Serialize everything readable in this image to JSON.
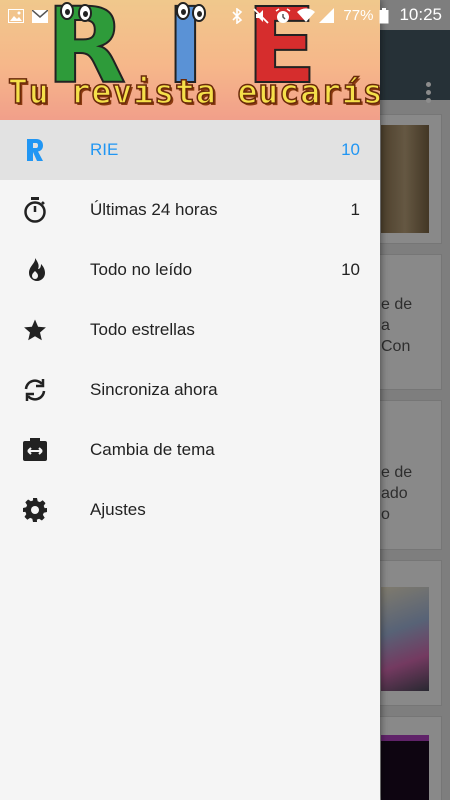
{
  "status_bar": {
    "battery_pct": "77%",
    "time": "10:25",
    "icons": [
      "image-icon",
      "mail-icon",
      "bluetooth-icon",
      "mute-icon",
      "alarm-icon",
      "wifi-icon",
      "signal-icon",
      "battery-icon"
    ]
  },
  "drawer": {
    "header": {
      "logo_letters": [
        "R",
        "I",
        "E"
      ],
      "tagline": "Tu revista eucarística"
    },
    "items": [
      {
        "label": "RIE",
        "count": "10",
        "icon": "rie-logo-icon",
        "active": true
      },
      {
        "label": "Últimas 24 horas",
        "count": "1",
        "icon": "stopwatch-icon"
      },
      {
        "label": "Todo no leído",
        "count": "10",
        "icon": "flame-icon"
      },
      {
        "label": "Todo estrellas",
        "count": "",
        "icon": "star-icon"
      },
      {
        "label": "Sincroniza ahora",
        "count": "",
        "icon": "sync-icon"
      },
      {
        "label": "Cambia de tema",
        "count": "",
        "icon": "theme-swap-icon"
      },
      {
        "label": "Ajustes",
        "count": "",
        "icon": "gear-icon"
      }
    ]
  },
  "background": {
    "card_snippets": [
      [
        "e de",
        "a",
        "Con"
      ],
      [
        "e de",
        "ado",
        "o"
      ]
    ]
  },
  "colors": {
    "accent": "#2196f3",
    "toolbar": "#455a64",
    "drawer_bg": "#f5f5f5",
    "active_row": "#e2e2e2"
  }
}
